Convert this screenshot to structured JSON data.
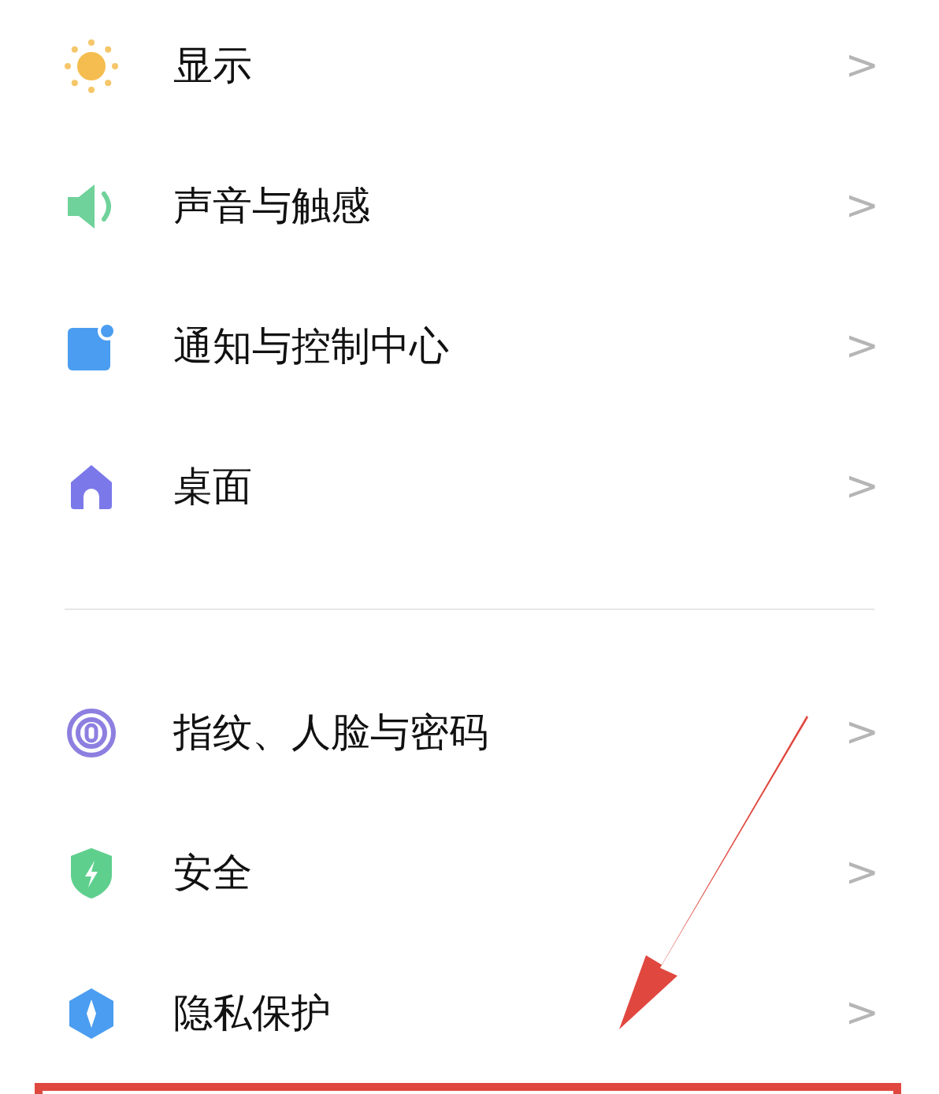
{
  "groups": [
    {
      "items": [
        {
          "label": "显示",
          "chevron": ">"
        },
        {
          "label": "声音与触感",
          "chevron": ">"
        },
        {
          "label": "通知与控制中心",
          "chevron": ">"
        },
        {
          "label": "桌面",
          "chevron": ">"
        }
      ]
    },
    {
      "items": [
        {
          "label": "指纹、人脸与密码",
          "chevron": ">"
        },
        {
          "label": "安全",
          "chevron": ">"
        },
        {
          "label": "隐私保护",
          "chevron": ">"
        }
      ]
    }
  ]
}
